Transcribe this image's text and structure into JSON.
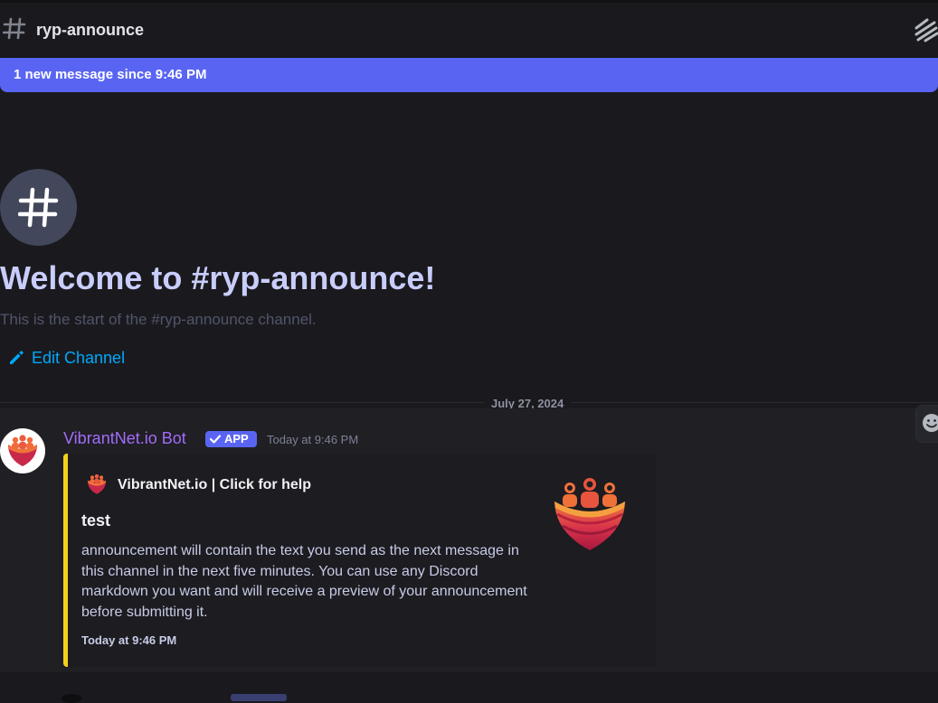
{
  "header": {
    "channel_name": "ryp-announce"
  },
  "banner": {
    "text": "1 new message since 9:46 PM"
  },
  "welcome": {
    "title": "Welcome to #ryp-announce!",
    "subtitle": "This is the start of the #ryp-announce channel.",
    "edit_channel_label": "Edit Channel"
  },
  "divider": {
    "date": "July 27, 2024"
  },
  "message": {
    "author": "VibrantNet.io Bot",
    "badge": "APP",
    "timestamp": "Today at 9:46 PM",
    "author_color": "#a46bfa",
    "embed": {
      "author_name": "VibrantNet.io | Click for help",
      "title": "test",
      "description": "announcement will contain the text you send as the next message in this channel in the next five minutes. You can use any Discord markdown you want and will receive a preview of your announcement before submitting it.",
      "footer": "Today at 9:46 PM",
      "accent_color": "#f4d11a"
    }
  },
  "colors": {
    "background": "#1a1a1e",
    "banner": "#5965f2",
    "link": "#00a8fc"
  },
  "icons": {
    "header_channel": "hash-icon",
    "header_threads": "threads-icon",
    "channel_avatar": "hash-icon",
    "edit": "pencil-icon",
    "badge": "checkmark-icon",
    "reaction": "emoji-icon"
  }
}
